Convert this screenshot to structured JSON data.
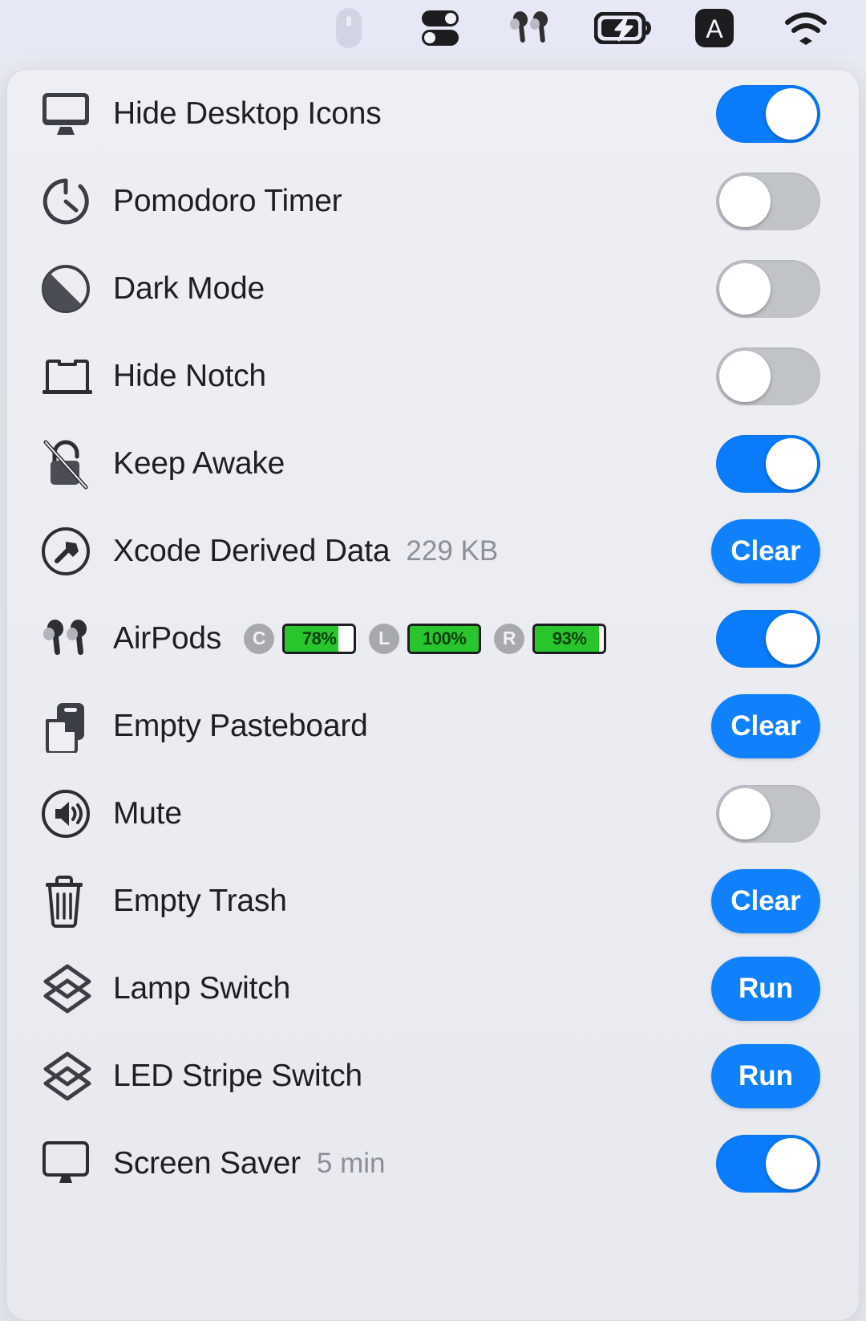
{
  "menubar": {
    "items": [
      {
        "name": "mouse-icon",
        "label": "Mouse",
        "dimmed": true
      },
      {
        "name": "toggles-icon",
        "label": "Toggles",
        "dimmed": false
      },
      {
        "name": "airpods-icon",
        "label": "AirPods",
        "dimmed": false
      },
      {
        "name": "battery-charging-icon",
        "label": "Battery Charging",
        "dimmed": false
      },
      {
        "name": "keyboard-input-icon",
        "label": "A",
        "dimmed": false
      },
      {
        "name": "wifi-icon",
        "label": "Wi-Fi",
        "dimmed": false
      }
    ]
  },
  "colors": {
    "accent_blue": "#0a7bfb",
    "button_blue": "#1181fb",
    "toggle_off_gray": "#c0c3c8",
    "battery_green": "#28c52c",
    "panel_bg": "#edeff4",
    "menubar_bg": "#e7e8f6",
    "label_text": "#1d1f23",
    "sublabel_text": "#8b8f97"
  },
  "rows": [
    {
      "id": "hide-desktop-icons",
      "icon": "display-icon",
      "label": "Hide Desktop Icons",
      "sublabel": "",
      "control": "toggle",
      "state": "on"
    },
    {
      "id": "pomodoro-timer",
      "icon": "timer-icon",
      "label": "Pomodoro Timer",
      "sublabel": "",
      "control": "toggle",
      "state": "off"
    },
    {
      "id": "dark-mode",
      "icon": "half-circle-icon",
      "label": "Dark Mode",
      "sublabel": "",
      "control": "toggle",
      "state": "off"
    },
    {
      "id": "hide-notch",
      "icon": "laptop-notch-icon",
      "label": "Hide Notch",
      "sublabel": "",
      "control": "toggle",
      "state": "off"
    },
    {
      "id": "keep-awake",
      "icon": "lock-slash-icon",
      "label": "Keep Awake",
      "sublabel": "",
      "control": "toggle",
      "state": "on"
    },
    {
      "id": "xcode-derived-data",
      "icon": "hammer-circle-icon",
      "label": "Xcode Derived Data",
      "sublabel": "229 KB",
      "control": "button",
      "button_label": "Clear"
    },
    {
      "id": "airpods",
      "icon": "airpods-icon",
      "label": "AirPods",
      "sublabel": "",
      "control": "toggle",
      "state": "on",
      "batteries": [
        {
          "tag": "C",
          "percent": "78%",
          "level": 78
        },
        {
          "tag": "L",
          "percent": "100%",
          "level": 100
        },
        {
          "tag": "R",
          "percent": "93%",
          "level": 93
        }
      ]
    },
    {
      "id": "empty-pasteboard",
      "icon": "pasteboard-icon",
      "label": "Empty Pasteboard",
      "sublabel": "",
      "control": "button",
      "button_label": "Clear"
    },
    {
      "id": "mute",
      "icon": "speaker-icon",
      "label": "Mute",
      "sublabel": "",
      "control": "toggle",
      "state": "off"
    },
    {
      "id": "empty-trash",
      "icon": "trash-icon",
      "label": "Empty Trash",
      "sublabel": "",
      "control": "button",
      "button_label": "Clear"
    },
    {
      "id": "lamp-switch",
      "icon": "shortcuts-icon",
      "label": "Lamp Switch",
      "sublabel": "",
      "control": "button",
      "button_label": "Run"
    },
    {
      "id": "led-stripe-switch",
      "icon": "shortcuts-icon",
      "label": "LED Stripe Switch",
      "sublabel": "",
      "control": "button",
      "button_label": "Run"
    },
    {
      "id": "screen-saver",
      "icon": "display-outline-icon",
      "label": "Screen Saver",
      "sublabel": "5 min",
      "control": "toggle",
      "state": "on"
    }
  ]
}
